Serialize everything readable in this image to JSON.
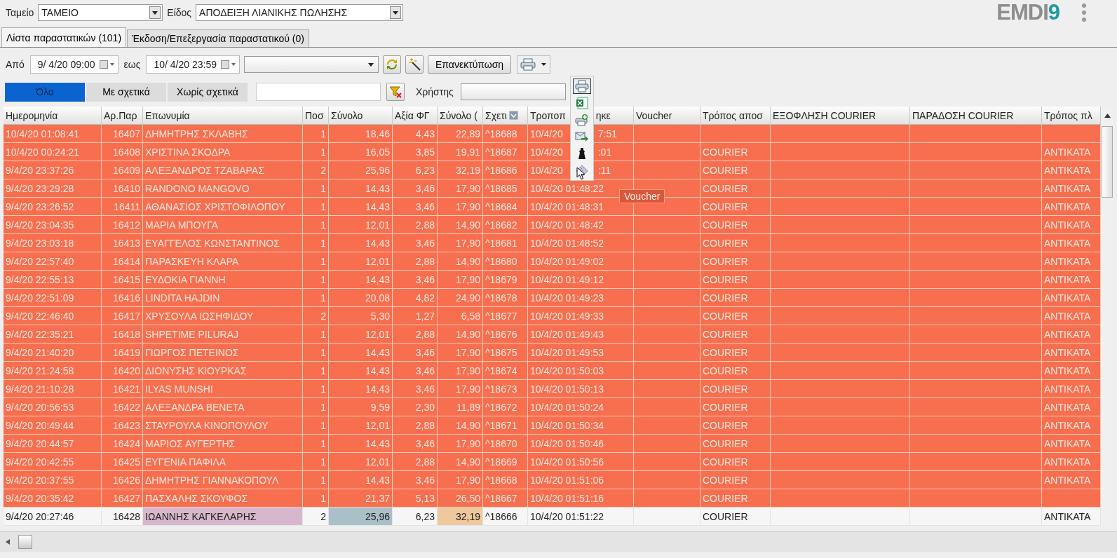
{
  "top": {
    "cash_label": "Ταμείο",
    "cash_value": "ΤΑΜΕΙΟ",
    "type_label": "Είδος",
    "type_value": "ΑΠΟΔΕΙΞΗ ΛΙΑΝΙΚΗΣ ΠΩΛΗΣΗΣ",
    "logo": {
      "text": "EMDI",
      "accent": "9"
    }
  },
  "tabs": [
    {
      "label": "Λίστα παραστατικών (101)",
      "selected": true
    },
    {
      "label": "Έκδοση/Επεξεργασία παραστατικού (0)",
      "selected": false
    }
  ],
  "filters": {
    "from_label": "Από",
    "from_value": "9/ 4/20 09:00",
    "to_label": "εως",
    "to_value": "10/ 4/20 23:59",
    "reprint_button": "Επανεκτύπωση",
    "user_label": "Χρήστης"
  },
  "segments": [
    {
      "label": "Όλα",
      "selected": true
    },
    {
      "label": "Με σχετικά",
      "selected": false
    },
    {
      "label": "Χωρίς σχετικά",
      "selected": false
    }
  ],
  "print_menu": [
    {
      "kind": "print",
      "selected": true
    },
    {
      "kind": "excel",
      "selected": false
    },
    {
      "kind": "print-add",
      "selected": false
    },
    {
      "kind": "email",
      "selected": false
    },
    {
      "kind": "figure",
      "selected": false
    },
    {
      "kind": "voucher",
      "selected": false
    }
  ],
  "tooltip": "Voucher",
  "columns": [
    {
      "label": "Ημερομηνία"
    },
    {
      "label": "Αρ.Παρ"
    },
    {
      "label": "Επωνυμία"
    },
    {
      "label": "Ποσ"
    },
    {
      "label": "Σύνολο"
    },
    {
      "label": "Αξία ΦΓ"
    },
    {
      "label": "Σύνολο ("
    },
    {
      "label": "Σχετι",
      "filter": true
    },
    {
      "label": "Τροποπ",
      "tail": "ηκε"
    },
    {
      "label": "Voucher"
    },
    {
      "label": "Τρόπος αποσ"
    },
    {
      "label": "ΕΞΟΦΛΗΣΗ COURIER"
    },
    {
      "label": "ΠΑΡΑΔΟΣΗ COURIER"
    },
    {
      "label": "Τρόπος πλ"
    }
  ],
  "rows": [
    {
      "highlighted": true,
      "date": "10/4/20 01:08:41",
      "no": "16407",
      "name": "ΔΗΜΗΤΡΗΣ ΣΚΛΑΒΗΣ",
      "qty": "1",
      "net": "18,46",
      "vat": "4,43",
      "gross": "22,89",
      "rel": "^18688",
      "modified": "10/4/20",
      "modified_tail": "7:51"
    },
    {
      "highlighted": true,
      "date": "10/4/20 00:24:21",
      "no": "16408",
      "name": "ΧΡΙΣΤΙΝΑ ΣΚΟΔΡΑ",
      "qty": "1",
      "net": "16,05",
      "vat": "3,85",
      "gross": "19,91",
      "rel": "^18687",
      "modified": "10/4/20",
      "modified_tail": ":01",
      "shipping": "COURIER",
      "payment": "ANTIKATA"
    },
    {
      "highlighted": true,
      "date": "9/4/20 23:37:26",
      "no": "16409",
      "name": "ΑΛΕΞΑΝΔΡΟΣ ΤΖΑΒΑΡΑΣ",
      "qty": "2",
      "net": "25,96",
      "vat": "6,23",
      "gross": "32,19",
      "rel": "^18686",
      "modified": "10/4/20",
      "modified_tail": ":11",
      "shipping": "COURIER",
      "payment": "ANTIKATA"
    },
    {
      "highlighted": true,
      "date": "9/4/20 23:29:28",
      "no": "16410",
      "name": "RANDONO MANGOVO",
      "qty": "1",
      "net": "14,43",
      "vat": "3,46",
      "gross": "17,90",
      "rel": "^18685",
      "modified": "10/4/20 01:48:22",
      "shipping": "COURIER",
      "payment": "ANTIKATA"
    },
    {
      "highlighted": true,
      "date": "9/4/20 23:26:52",
      "no": "16411",
      "name": "ΑΘΑΝΑΣΙΟΣ ΧΡΙΣΤΟΦΙΛΟΠΟΥ",
      "qty": "1",
      "net": "14,43",
      "vat": "3,46",
      "gross": "17,90",
      "rel": "^18684",
      "modified": "10/4/20 01:48:31",
      "shipping": "COURIER",
      "payment": "ANTIKATA"
    },
    {
      "highlighted": true,
      "date": "9/4/20 23:04:35",
      "no": "16412",
      "name": "ΜΑΡΙΑ ΜΠΟΥΓΑ",
      "qty": "1",
      "net": "12,01",
      "vat": "2,88",
      "gross": "14,90",
      "rel": "^18682",
      "modified": "10/4/20 01:48:42",
      "shipping": "COURIER",
      "payment": "ANTIKATA"
    },
    {
      "highlighted": true,
      "date": "9/4/20 23:03:18",
      "no": "16413",
      "name": "ΕΥΑΓΓΕΛΟΣ ΚΩΝΣΤΑΝΤΙΝΟΣ",
      "qty": "1",
      "net": "14,43",
      "vat": "3,46",
      "gross": "17,90",
      "rel": "^18681",
      "modified": "10/4/20 01:48:52",
      "shipping": "COURIER",
      "payment": "ANTIKATA"
    },
    {
      "highlighted": true,
      "date": "9/4/20 22:57:40",
      "no": "16414",
      "name": "ΠΑΡΑΣΚΕΥΗ ΚΛΑΡΑ",
      "qty": "1",
      "net": "12,01",
      "vat": "2,88",
      "gross": "14,90",
      "rel": "^18680",
      "modified": "10/4/20 01:49:02",
      "shipping": "COURIER",
      "payment": "ANTIKATA"
    },
    {
      "highlighted": true,
      "date": "9/4/20 22:55:13",
      "no": "16415",
      "name": "ΕΥΔΟΚΙΑ ΓΙΑΝΝΗ",
      "qty": "1",
      "net": "14,43",
      "vat": "3,46",
      "gross": "17,90",
      "rel": "^18679",
      "modified": "10/4/20 01:49:12",
      "shipping": "COURIER",
      "payment": "ANTIKATA"
    },
    {
      "highlighted": true,
      "date": "9/4/20 22:51:09",
      "no": "16416",
      "name": "LINDITA HAJDIN",
      "qty": "1",
      "net": "20,08",
      "vat": "4,82",
      "gross": "24,90",
      "rel": "^18678",
      "modified": "10/4/20 01:49:23",
      "shipping": "COURIER",
      "payment": "ANTIKATA"
    },
    {
      "highlighted": true,
      "date": "9/4/20 22:46:40",
      "no": "16417",
      "name": "ΧΡΥΣΟΥΛΑ ΙΩΣΗΦΙΔΟΥ",
      "qty": "2",
      "net": "5,30",
      "vat": "1,27",
      "gross": "6,58",
      "rel": "^18677",
      "modified": "10/4/20 01:49:33",
      "shipping": "COURIER",
      "payment": "ANTIKATA"
    },
    {
      "highlighted": true,
      "date": "9/4/20 22:35:21",
      "no": "16418",
      "name": "SHPETIME PILURAJ",
      "qty": "1",
      "net": "12,01",
      "vat": "2,88",
      "gross": "14,90",
      "rel": "^18676",
      "modified": "10/4/20 01:49:43",
      "shipping": "COURIER",
      "payment": "ANTIKATA"
    },
    {
      "highlighted": true,
      "date": "9/4/20 21:40:20",
      "no": "16419",
      "name": "ΓΙΩΡΓΟΣ ΠΕΤΕΙΝΟΣ",
      "qty": "1",
      "net": "14,43",
      "vat": "3,46",
      "gross": "17,90",
      "rel": "^18675",
      "modified": "10/4/20 01:49:53",
      "shipping": "COURIER",
      "payment": "ANTIKATA"
    },
    {
      "highlighted": true,
      "date": "9/4/20 21:24:58",
      "no": "16420",
      "name": "ΔΙΟΝΥΣΗΣ ΚΙΟΥΡΚΑΣ",
      "qty": "1",
      "net": "14,43",
      "vat": "3,46",
      "gross": "17,90",
      "rel": "^18674",
      "modified": "10/4/20 01:50:03",
      "shipping": "COURIER",
      "payment": "ANTIKATA"
    },
    {
      "highlighted": true,
      "date": "9/4/20 21:10:28",
      "no": "16421",
      "name": "ILYAS MUNSHI",
      "qty": "1",
      "net": "14,43",
      "vat": "3,46",
      "gross": "17,90",
      "rel": "^18673",
      "modified": "10/4/20 01:50:13",
      "shipping": "COURIER",
      "payment": "ANTIKATA"
    },
    {
      "highlighted": true,
      "date": "9/4/20 20:56:53",
      "no": "16422",
      "name": "ΑΛΕΞΑΝΔΡΑ ΒΕΝΕΤΑ",
      "qty": "1",
      "net": "9,59",
      "vat": "2,30",
      "gross": "11,89",
      "rel": "^18672",
      "modified": "10/4/20 01:50:24",
      "shipping": "COURIER",
      "payment": "ANTIKATA"
    },
    {
      "highlighted": true,
      "date": "9/4/20 20:49:44",
      "no": "16423",
      "name": "ΣΤΑΥΡΟΥΛΑ ΚΙΝΟΠΟΥΛΟΥ",
      "qty": "1",
      "net": "12,01",
      "vat": "2,88",
      "gross": "14,90",
      "rel": "^18671",
      "modified": "10/4/20 01:50:34",
      "shipping": "COURIER",
      "payment": "ANTIKATA"
    },
    {
      "highlighted": true,
      "date": "9/4/20 20:44:57",
      "no": "16424",
      "name": "ΜΑΡΙΟΣ ΑΥΓΕΡΤΗΣ",
      "qty": "1",
      "net": "14,43",
      "vat": "3,46",
      "gross": "17,90",
      "rel": "^18670",
      "modified": "10/4/20 01:50:46",
      "shipping": "COURIER",
      "payment": "ANTIKATA"
    },
    {
      "highlighted": true,
      "date": "9/4/20 20:42:55",
      "no": "16425",
      "name": "ΕΥΓΕΝΙΑ ΠΑΦΙΛΑ",
      "qty": "1",
      "net": "12,01",
      "vat": "2,88",
      "gross": "14,90",
      "rel": "^18669",
      "modified": "10/4/20 01:50:56",
      "shipping": "COURIER",
      "payment": "ANTIKATA"
    },
    {
      "highlighted": true,
      "date": "9/4/20 20:37:55",
      "no": "16426",
      "name": "ΔΗΜΗΤΡΗΣ ΓΙΑΝΝΑΚΟΠΟΥΛ",
      "qty": "1",
      "net": "14,43",
      "vat": "3,46",
      "gross": "17,90",
      "rel": "^18668",
      "modified": "10/4/20 01:51:06",
      "shipping": "COURIER",
      "payment": "ANTIKATA"
    },
    {
      "highlighted": true,
      "date": "9/4/20 20:35:42",
      "no": "16427",
      "name": "ΠΑΣΧΑΛΗΣ ΣΚΟΥΦΟΣ",
      "qty": "1",
      "net": "21,37",
      "vat": "5,13",
      "gross": "26,50",
      "rel": "^18667",
      "modified": "10/4/20 01:51:16",
      "shipping": "COURIER"
    },
    {
      "highlighted": false,
      "date": "9/4/20 20:27:46",
      "no": "16428",
      "name": "ΙΩΑΝΝΗΣ ΚΑΓΚΕΛΑΡΗΣ",
      "qty": "2",
      "net": "25,96",
      "vat": "6,23",
      "gross": "32,19",
      "rel": "^18666",
      "modified": "10/4/20 01:51:22",
      "shipping": "COURIER",
      "payment": "ANTIKATA",
      "tints": {
        "name": {
          "color": "#d7b7cb"
        },
        "net": {
          "color": "#a9c0c7"
        },
        "gross": {
          "color": "#efc89c"
        }
      }
    }
  ]
}
